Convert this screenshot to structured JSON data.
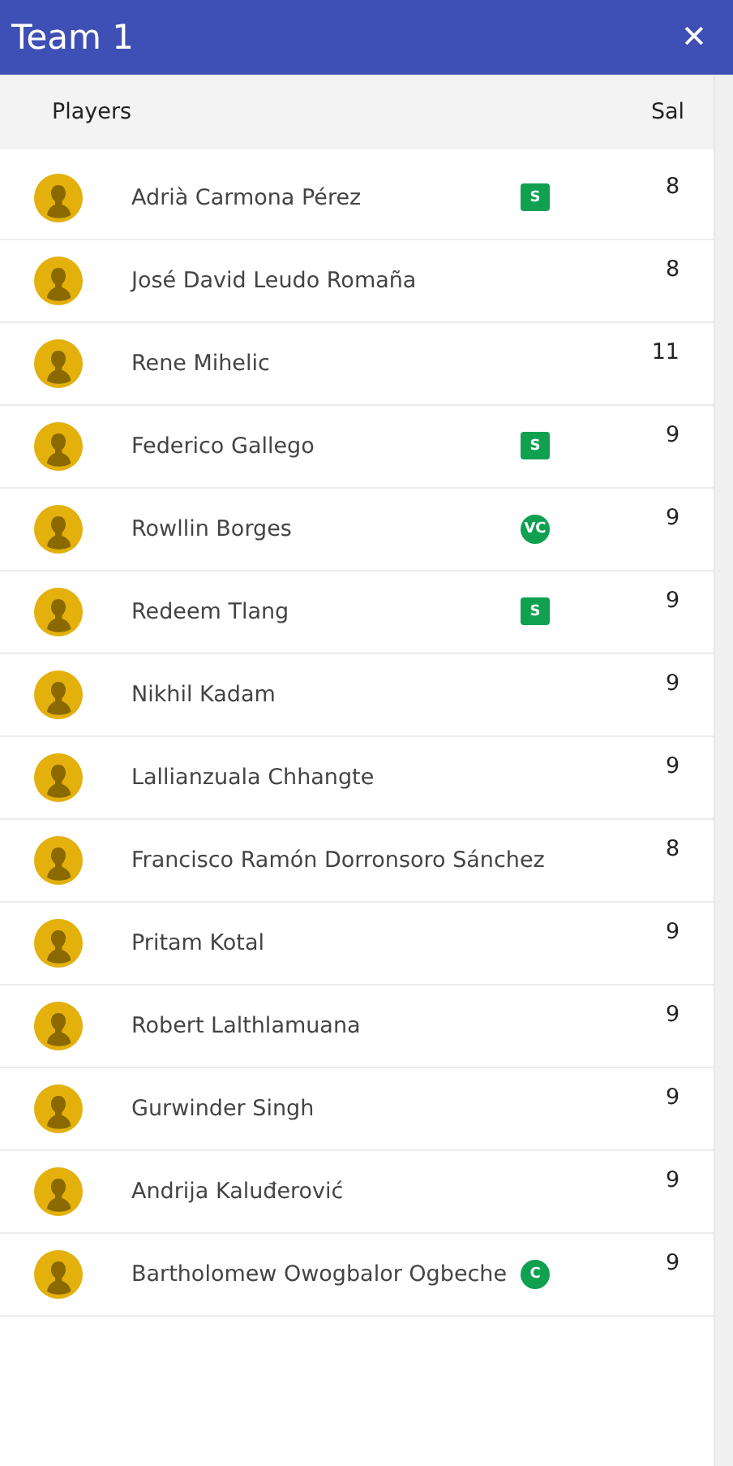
{
  "header": {
    "title": "Team 1",
    "close": "✕"
  },
  "columns": {
    "players": "Players",
    "salary": "Sal"
  },
  "players": [
    {
      "name": "Adrià Carmona Pérez",
      "badge": {
        "kind": "square",
        "text": "S"
      },
      "salary": "8"
    },
    {
      "name": "José David Leudo Romaña",
      "salary": "8"
    },
    {
      "name": "Rene Mihelic",
      "salary": "11"
    },
    {
      "name": "Federico Gallego",
      "badge": {
        "kind": "square",
        "text": "S"
      },
      "salary": "9"
    },
    {
      "name": "Rowllin Borges",
      "badge": {
        "kind": "round",
        "text": "VC"
      },
      "salary": "9"
    },
    {
      "name": "Redeem Tlang",
      "badge": {
        "kind": "square",
        "text": "S"
      },
      "salary": "9"
    },
    {
      "name": "Nikhil Kadam",
      "salary": "9"
    },
    {
      "name": "Lallianzuala Chhangte",
      "salary": "9"
    },
    {
      "name": "Francisco Ramón Dorronsoro Sánchez",
      "salary": "8"
    },
    {
      "name": "Pritam Kotal",
      "salary": "9"
    },
    {
      "name": "Robert Lalthlamuana",
      "salary": "9"
    },
    {
      "name": "Gurwinder Singh",
      "salary": "9"
    },
    {
      "name": "Andrija Kaluđerović",
      "salary": "9"
    },
    {
      "name": "Bartholomew Owogbalor Ogbeche",
      "badge": {
        "kind": "round",
        "text": "C"
      },
      "salary": "9"
    }
  ]
}
